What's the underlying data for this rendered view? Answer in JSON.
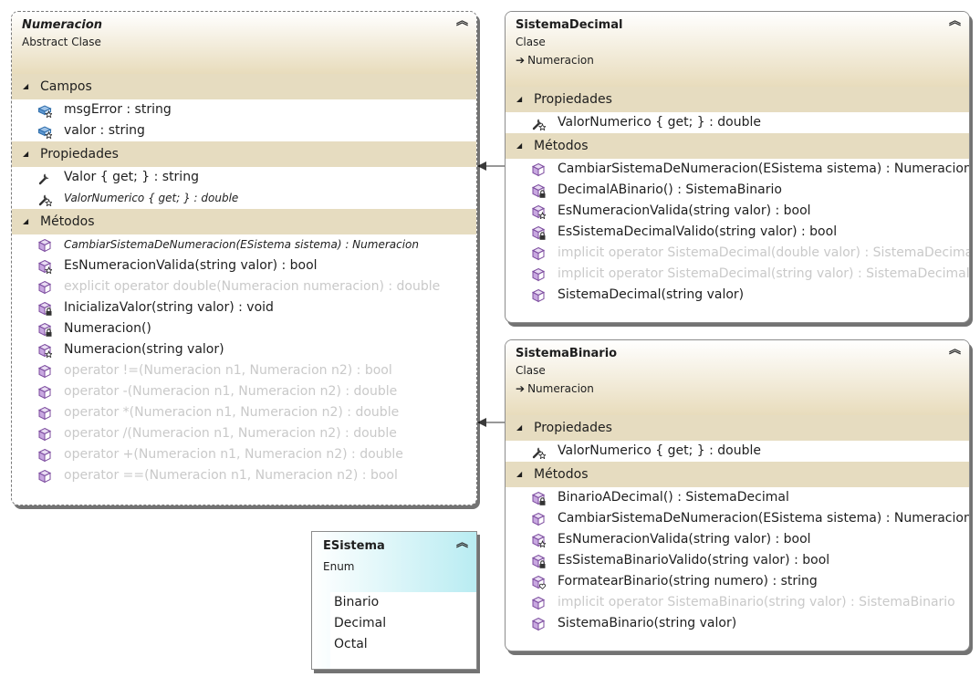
{
  "numeracion": {
    "name": "Numeracion",
    "stereotype": "Abstract Clase",
    "sections": [
      {
        "label": "Campos",
        "items": [
          {
            "text": "msgError : string",
            "icon": "field-protected-icon",
            "dim": false,
            "italic": false
          },
          {
            "text": "valor : string",
            "icon": "field-protected-icon",
            "dim": false,
            "italic": false
          }
        ]
      },
      {
        "label": "Propiedades",
        "items": [
          {
            "text": "Valor { get; } : string",
            "icon": "property-icon",
            "dim": false,
            "italic": false
          },
          {
            "text": "ValorNumerico { get; } : double",
            "icon": "property-protected-icon",
            "dim": false,
            "italic": true
          }
        ]
      },
      {
        "label": "Métodos",
        "items": [
          {
            "text": "CambiarSistemaDeNumeracion(ESistema  sistema)  :  Numeracion",
            "icon": "method-public-icon",
            "dim": false,
            "italic": true
          },
          {
            "text": "EsNumeracionValida(string valor) : bool",
            "icon": "method-protected-icon",
            "dim": false,
            "italic": false
          },
          {
            "text": "explicit operator double(Numeracion numeracion) : double",
            "icon": "method-public-icon",
            "dim": true,
            "italic": false
          },
          {
            "text": "InicializaValor(string valor) : void",
            "icon": "method-private-icon",
            "dim": false,
            "italic": false
          },
          {
            "text": "Numeracion()",
            "icon": "method-private-icon",
            "dim": false,
            "italic": false
          },
          {
            "text": "Numeracion(string valor)",
            "icon": "method-protected-icon",
            "dim": false,
            "italic": false
          },
          {
            "text": "operator !=(Numeracion n1, Numeracion n2) : bool",
            "icon": "method-public-icon",
            "dim": true,
            "italic": false
          },
          {
            "text": "operator -(Numeracion n1, Numeracion n2) : double",
            "icon": "method-public-icon",
            "dim": true,
            "italic": false
          },
          {
            "text": "operator *(Numeracion n1, Numeracion n2) : double",
            "icon": "method-public-icon",
            "dim": true,
            "italic": false
          },
          {
            "text": "operator /(Numeracion n1, Numeracion n2) : double",
            "icon": "method-public-icon",
            "dim": true,
            "italic": false
          },
          {
            "text": "operator +(Numeracion n1, Numeracion n2) : double",
            "icon": "method-public-icon",
            "dim": true,
            "italic": false
          },
          {
            "text": "operator ==(Numeracion n1, Numeracion n2) : bool",
            "icon": "method-public-icon",
            "dim": true,
            "italic": false
          }
        ]
      }
    ]
  },
  "sistemaDecimal": {
    "name": "SistemaDecimal",
    "stereotype": "Clase",
    "base": "Numeracion",
    "sections": [
      {
        "label": "Propiedades",
        "items": [
          {
            "text": "ValorNumerico { get; } : double",
            "icon": "property-protected-icon",
            "dim": false,
            "italic": false
          }
        ]
      },
      {
        "label": "Métodos",
        "items": [
          {
            "text": "CambiarSistemaDeNumeracion(ESistema sistema) : Numeracion",
            "icon": "method-public-icon",
            "dim": false,
            "italic": false
          },
          {
            "text": "DecimalABinario() : SistemaBinario",
            "icon": "method-private-icon",
            "dim": false,
            "italic": false
          },
          {
            "text": "EsNumeracionValida(string valor) : bool",
            "icon": "method-protected-icon",
            "dim": false,
            "italic": false
          },
          {
            "text": "EsSistemaDecimalValido(string valor) : bool",
            "icon": "method-private-icon",
            "dim": false,
            "italic": false
          },
          {
            "text": "implicit operator SistemaDecimal(double valor) : SistemaDecimal",
            "icon": "method-public-icon",
            "dim": true,
            "italic": false
          },
          {
            "text": "implicit operator SistemaDecimal(string valor) : SistemaDecimal",
            "icon": "method-public-icon",
            "dim": true,
            "italic": false
          },
          {
            "text": "SistemaDecimal(string valor)",
            "icon": "method-public-icon",
            "dim": false,
            "italic": false
          }
        ]
      }
    ]
  },
  "sistemaBinario": {
    "name": "SistemaBinario",
    "stereotype": "Clase",
    "base": "Numeracion",
    "sections": [
      {
        "label": "Propiedades",
        "items": [
          {
            "text": "ValorNumerico { get; } : double",
            "icon": "property-protected-icon",
            "dim": false,
            "italic": false
          }
        ]
      },
      {
        "label": "Métodos",
        "items": [
          {
            "text": "BinarioADecimal() : SistemaDecimal",
            "icon": "method-private-icon",
            "dim": false,
            "italic": false
          },
          {
            "text": "CambiarSistemaDeNumeracion(ESistema sistema) : Numeracion",
            "icon": "method-public-icon",
            "dim": false,
            "italic": false
          },
          {
            "text": "EsNumeracionValida(string valor) : bool",
            "icon": "method-protected-icon",
            "dim": false,
            "italic": false
          },
          {
            "text": "EsSistemaBinarioValido(string valor) : bool",
            "icon": "method-private-icon",
            "dim": false,
            "italic": false
          },
          {
            "text": "FormatearBinario(string numero) : string",
            "icon": "method-internal-icon",
            "dim": false,
            "italic": false
          },
          {
            "text": "implicit operator SistemaBinario(string valor) : SistemaBinario",
            "icon": "method-public-icon",
            "dim": true,
            "italic": false
          },
          {
            "text": "SistemaBinario(string valor)",
            "icon": "method-public-icon",
            "dim": false,
            "italic": false
          }
        ]
      }
    ]
  },
  "eSistema": {
    "name": "ESistema",
    "stereotype": "Enum",
    "values": [
      "Binario",
      "Decimal",
      "Octal"
    ]
  },
  "colors": {
    "header": "#e8dcbc",
    "section": "#e6dcc0",
    "enum": "#b9ecf2",
    "dim_text": "#c9c9c9"
  }
}
